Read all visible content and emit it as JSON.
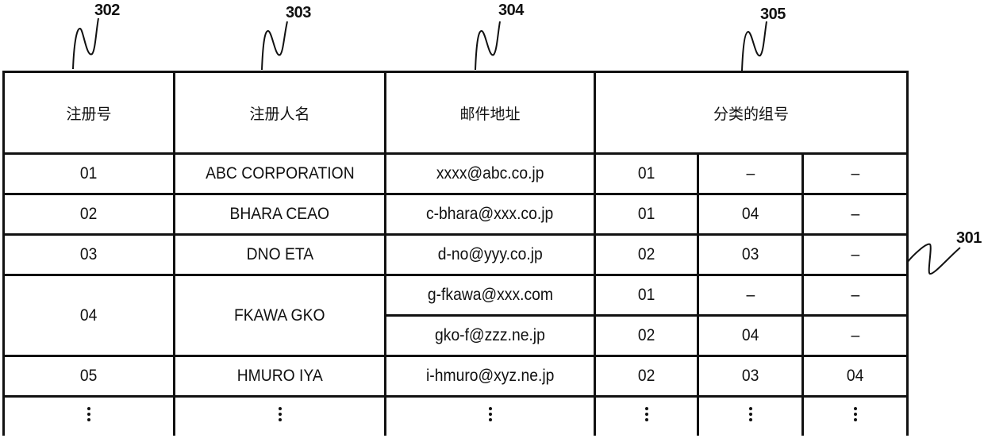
{
  "figure": {
    "table_ref": "301",
    "column_refs": [
      "302",
      "303",
      "304",
      "305"
    ]
  },
  "headers": {
    "reg_no": "注册号",
    "reg_name": "注册人名",
    "email": "邮件地址",
    "group_no": "分类的组号"
  },
  "rows": [
    {
      "reg_no": "01",
      "name": "ABC CORPORATION",
      "emails": [
        {
          "address": "xxxx@abc.co.jp",
          "groups": [
            "01",
            "–",
            "–"
          ]
        }
      ]
    },
    {
      "reg_no": "02",
      "name": "BHARA CEAO",
      "emails": [
        {
          "address": "c-bhara@xxx.co.jp",
          "groups": [
            "01",
            "04",
            "–"
          ]
        }
      ]
    },
    {
      "reg_no": "03",
      "name": "DNO ETA",
      "emails": [
        {
          "address": "d-no@yyy.co.jp",
          "groups": [
            "02",
            "03",
            "–"
          ]
        }
      ]
    },
    {
      "reg_no": "04",
      "name": "FKAWA GKO",
      "emails": [
        {
          "address": "g-fkawa@xxx.com",
          "groups": [
            "01",
            "–",
            "–"
          ]
        },
        {
          "address": "gko-f@zzz.ne.jp",
          "groups": [
            "02",
            "04",
            "–"
          ]
        }
      ]
    },
    {
      "reg_no": "05",
      "name": "HMURO IYA",
      "emails": [
        {
          "address": "i-hmuro@xyz.ne.jp",
          "groups": [
            "02",
            "03",
            "04"
          ]
        }
      ]
    }
  ],
  "continuation": "⋮"
}
